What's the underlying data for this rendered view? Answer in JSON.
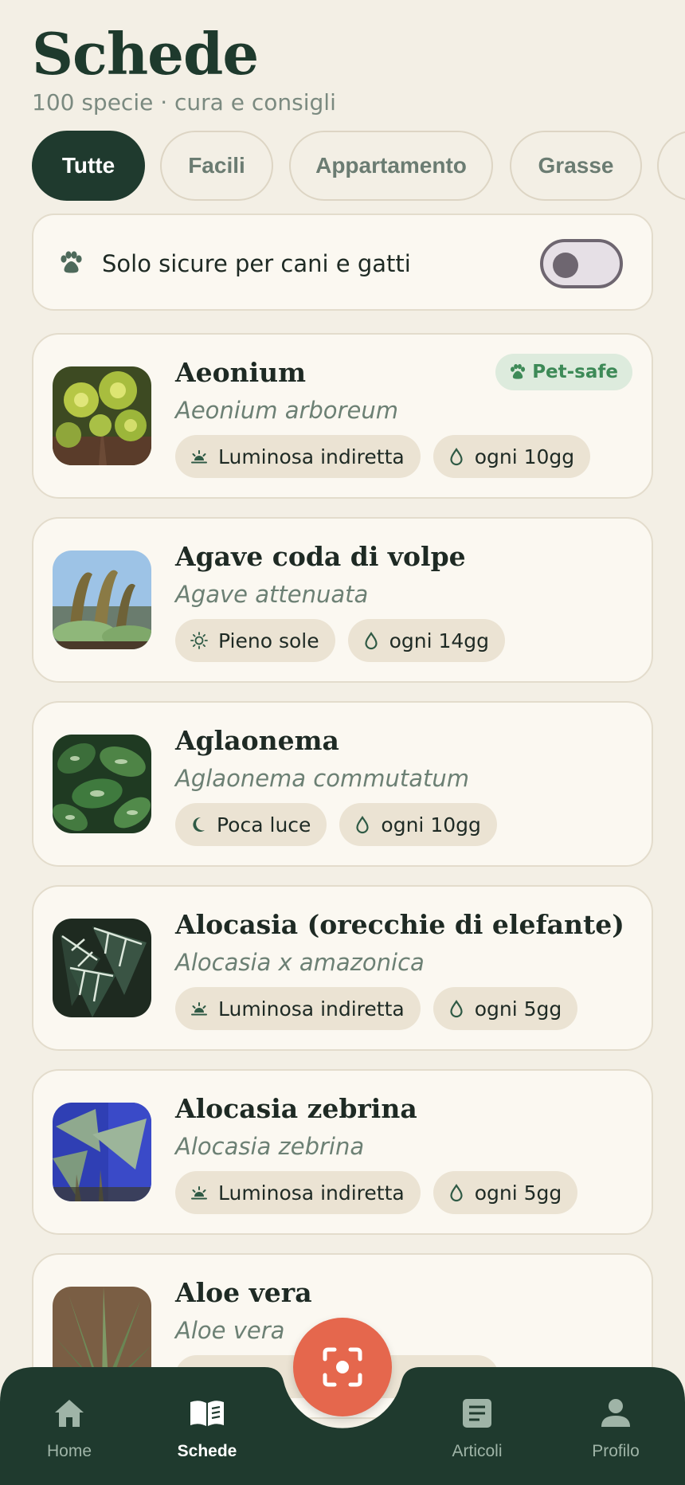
{
  "header": {
    "title": "Schede",
    "subtitle": "100 specie · cura e consigli"
  },
  "filters": [
    "Tutte",
    "Facili",
    "Appartamento",
    "Grasse",
    ""
  ],
  "active_filter": "Tutte",
  "pet_filter": {
    "label": "Solo sicure per cani e gatti",
    "enabled": false,
    "icon": "paw-icon"
  },
  "plants": [
    {
      "name": "Aeonium",
      "scientific": "Aeonium arboreum",
      "light": "Luminosa indiretta",
      "light_icon": "sunrise-icon",
      "water": "ogni 10gg",
      "badge": "Pet-safe"
    },
    {
      "name": "Agave coda di volpe",
      "scientific": "Agave attenuata",
      "light": "Pieno sole",
      "light_icon": "sun-icon",
      "water": "ogni 14gg"
    },
    {
      "name": "Aglaonema",
      "scientific": "Aglaonema commutatum",
      "light": "Poca luce",
      "light_icon": "moon-icon",
      "water": "ogni 10gg"
    },
    {
      "name": "Alocasia (orecchie di elefante)",
      "scientific": "Alocasia x amazonica",
      "light": "Luminosa indiretta",
      "light_icon": "sunrise-icon",
      "water": "ogni 5gg"
    },
    {
      "name": "Alocasia zebrina",
      "scientific": "Alocasia zebrina",
      "light": "Luminosa indiretta",
      "light_icon": "sunrise-icon",
      "water": "ogni 5gg"
    },
    {
      "name": "Aloe vera",
      "scientific": "Aloe vera",
      "light": "",
      "light_icon": "sun-icon",
      "water": ""
    }
  ],
  "nav": {
    "home": "Home",
    "schede": "Schede",
    "articoli": "Articoli",
    "profilo": "Profilo",
    "active": "Schede"
  },
  "colors": {
    "primary": "#1F3A2E",
    "accent": "#E5674D",
    "background": "#F3EFE5",
    "card": "#FBF8F1",
    "petsafe": "#3D8A57"
  }
}
